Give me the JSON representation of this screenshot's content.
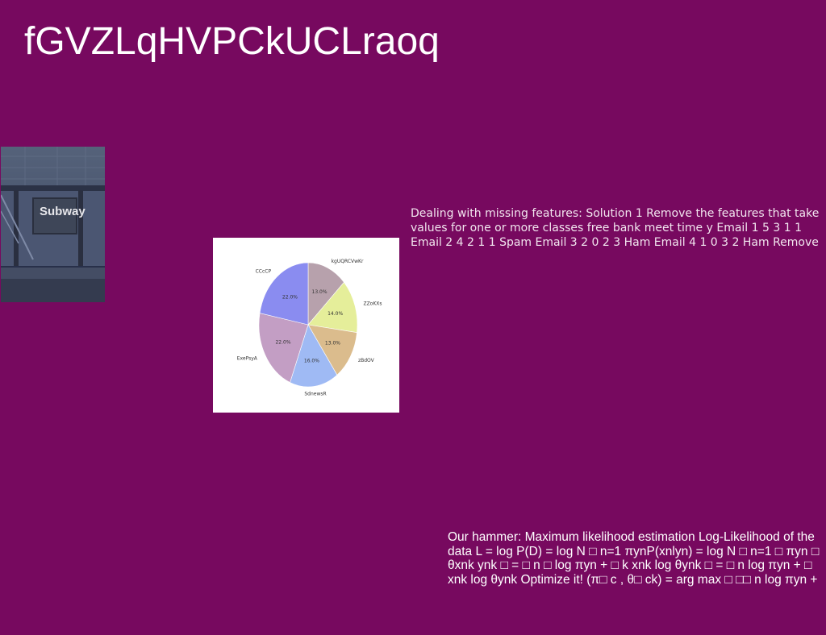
{
  "title": "fGVZLqHVPCkUCLraoq",
  "photo": {
    "sign_text": "Subway"
  },
  "chart_data": {
    "type": "pie",
    "slices": [
      {
        "label": "kgUQRCVwKr",
        "value": 13.0,
        "pct_label": "13.0%",
        "color": "#b7a1ac"
      },
      {
        "label": "ZZoKXs",
        "value": 14.0,
        "pct_label": "14.0%",
        "color": "#e5ee9a"
      },
      {
        "label": "zBdOV",
        "value": 13.0,
        "pct_label": "13.0%",
        "color": "#dbbc8d"
      },
      {
        "label": "SdnewsR",
        "value": 16.0,
        "pct_label": "16.0%",
        "color": "#9fbaf4"
      },
      {
        "label": "ExePsyA",
        "value": 22.0,
        "pct_label": "22.0%",
        "color": "#c39ec4"
      },
      {
        "label": "CCcCP",
        "value": 22.0,
        "pct_label": "22.0%",
        "color": "#8a8cf0"
      }
    ]
  },
  "text_block_1": "Dealing with missing features: Solution 1 Remove the features that take values for one or more classes free bank meet time y Email 1 5 3 1 1 Email 2 4 2 1 1 Spam Email 3 2 0 2 3 Ham Email 4 1 0 3 2 Ham Remove",
  "text_block_2": "Our hammer: Maximum likelihood estimation Log-Likelihood of the data L = log P(D) = log N □ n=1 πynP(xnlyn) = log N □ n=1 □ πyn □ θxnk ynk □ = □ n □ log πyn + □ k xnk log θynk □ = □ n log πyn + □ xnk log θynk Optimize it! (π□ c , θ□ ck) = arg max □ □□ n log πyn +"
}
